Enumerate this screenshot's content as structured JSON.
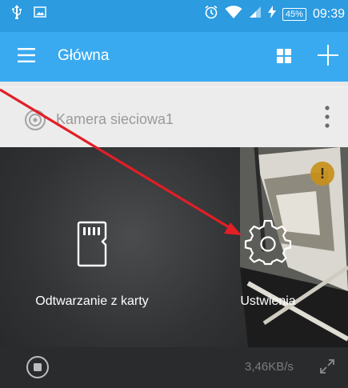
{
  "status_bar": {
    "time": "09:39",
    "battery": "45%"
  },
  "app_bar": {
    "title": "Główna"
  },
  "camera": {
    "name": "Kamera sieciowa1"
  },
  "actions": {
    "sd_playback": "Odtwarzanie z karty",
    "settings": "Ustwienia"
  },
  "warning_badge": "!",
  "bottom_bar": {
    "speed": "3,46KB/s"
  },
  "colors": {
    "status_bar": "#2c9be0",
    "app_bar": "#3aaaf0",
    "annotation_arrow": "#e21e26",
    "warning": "#c89018"
  },
  "icons": [
    "usb-icon",
    "image-icon",
    "alarm-icon",
    "wifi-icon",
    "signal-icon",
    "charging-icon",
    "menu-icon",
    "grid-icon",
    "plus-icon",
    "camera-icon",
    "more-vertical-icon",
    "sd-card-icon",
    "gear-icon",
    "stop-icon",
    "expand-icon"
  ]
}
